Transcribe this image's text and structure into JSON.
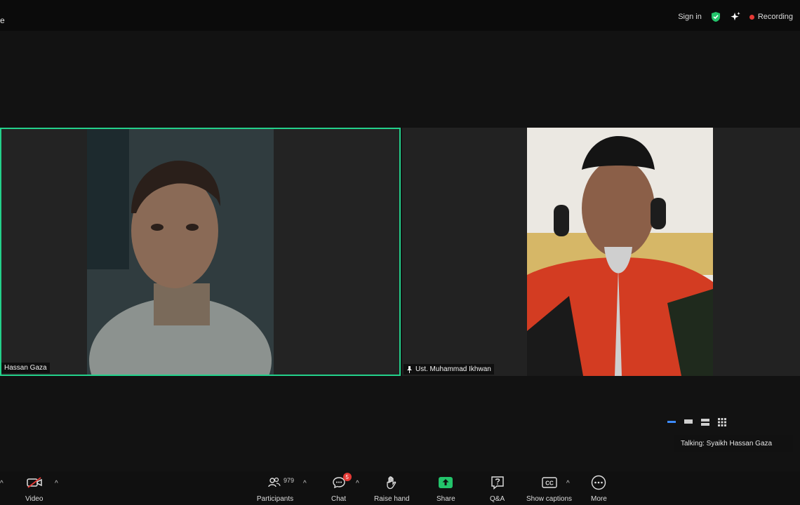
{
  "window": {
    "title_fragment": "e"
  },
  "top_right": {
    "signin_label": "Sign in",
    "recording_label": "Recording",
    "shield_icon": "shield-check-icon",
    "sparkle_icon": "sparkle-icon",
    "accent_green": "#23d18b",
    "recording_color": "#e53935"
  },
  "participants": [
    {
      "name": "Hassan Gaza",
      "active_speaker": true
    },
    {
      "name": "Ust. Muhammad Ikhwan",
      "pinned": true
    }
  ],
  "talking": {
    "label": "Talking: Syaikh Hassan Gaza"
  },
  "toolbar": {
    "video_label": "Video",
    "participants_label": "Participants",
    "participants_count": "979",
    "chat_label": "Chat",
    "chat_badge": "5",
    "raise_hand_label": "Raise hand",
    "share_label": "Share",
    "qa_label": "Q&A",
    "captions_label": "Show captions",
    "captions_icon_text": "CC",
    "more_label": "More"
  }
}
